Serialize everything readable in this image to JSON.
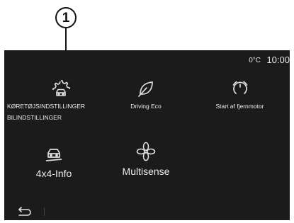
{
  "callout": {
    "number": "1"
  },
  "status": {
    "temperature": "0°C",
    "time": "10:00"
  },
  "tiles": [
    {
      "label_lines": [
        "KØRETØJSINDSTILLINGER",
        "BILINDSTILLINGER"
      ],
      "icon": "gear-car-icon"
    },
    {
      "label": "Driving Eco",
      "icon": "leaf-icon"
    },
    {
      "label": "Start af fjernmotor",
      "icon": "remote-start-icon"
    },
    {
      "label": "4x4-Info",
      "icon": "4x4-car-icon"
    },
    {
      "label": "Multisense",
      "icon": "multisense-flower-icon"
    }
  ],
  "bottom": {
    "back_icon": "back-arrow-icon"
  },
  "colors": {
    "screen_bg": "#1b1b1b",
    "text": "#ececec",
    "icon": "#dddddd"
  }
}
